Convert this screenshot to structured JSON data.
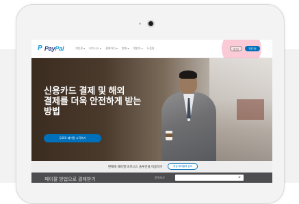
{
  "header": {
    "logo_mark": "P",
    "logo_pay": "Pay",
    "logo_pal": "Pal",
    "nav": [
      "개인용 ▾",
      "비즈니스 ▾",
      "결제하기 ▾",
      "판매 ▾",
      "개발자 ▾",
      "도움말"
    ],
    "login_label": "로그인",
    "signup_label": "회원가입"
  },
  "hero": {
    "title_lines": [
      "신용카드 결제 및 해외",
      "결제를 더욱 안전하게 받는",
      "방법"
    ],
    "cta_label": "무료로 페이팔 시작하기"
  },
  "promo_bar": {
    "text": "판매에 페이팔 비즈니스 솔루션을 이용하기",
    "button_label": "지금 페이팔과 상의"
  },
  "footer": {
    "text": "페이팔 방법으로 결제받기",
    "label": "문의하기"
  },
  "colors": {
    "paypal_blue": "#0070ba",
    "paypal_navy": "#253b80",
    "paypal_light": "#179bd7",
    "highlight": "#f5a0b4"
  }
}
